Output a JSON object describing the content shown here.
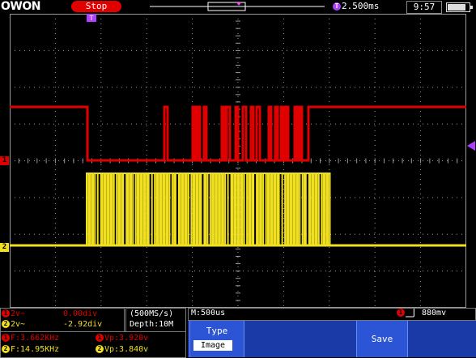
{
  "header": {
    "logo": "OWON",
    "run_state": "Stop",
    "timebase": "2.500ms",
    "time": "9:57",
    "battery_level": 0.85
  },
  "channel_markers": {
    "ch1": "1",
    "ch2": "2"
  },
  "status": {
    "ch1_volts": "2v~",
    "ch1_offset": "0.00div",
    "ch2_volts": "2v~",
    "ch2_offset": "-2.92div",
    "sample_rate": "(500MS/s)",
    "depth": "Depth:10M",
    "ch1_freq": "F:3.662KHz",
    "ch2_freq": "F:14.95KHz",
    "ch1_vp": "Vp:3.920v",
    "ch2_vp": "Vp:3.840v",
    "main_timebase": "M:500us",
    "trigger_level": "880mv"
  },
  "menu": {
    "type_label": "Type",
    "type_value": "Image",
    "save_label": "Save"
  },
  "colors": {
    "ch1": "#e00000",
    "ch2": "#f0e020",
    "grid": "#9a9a9a",
    "menu_bg": "#1a3aa8",
    "menu_button": "#2c55d6"
  }
}
